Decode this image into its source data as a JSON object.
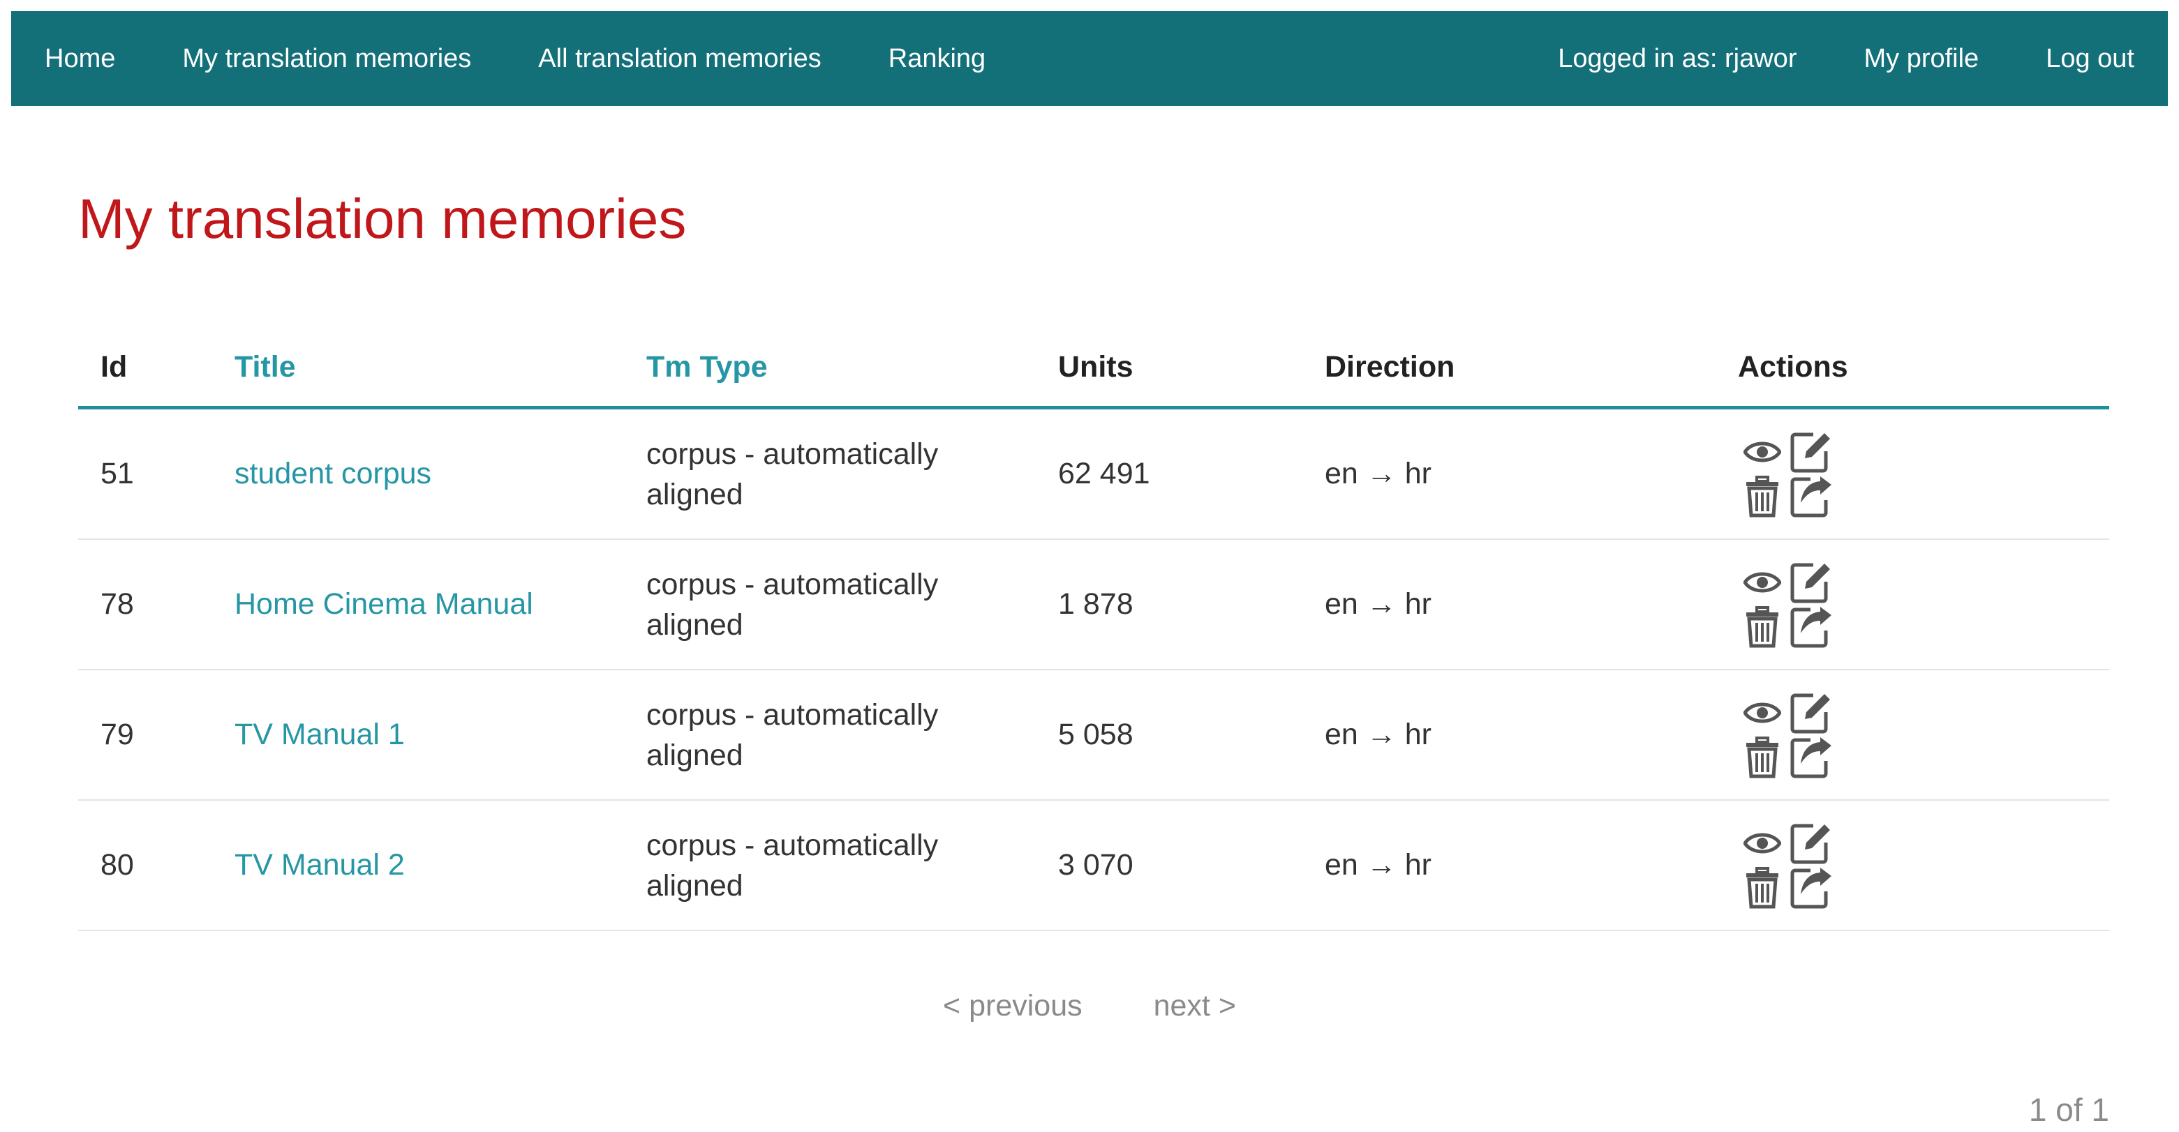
{
  "nav": {
    "home": "Home",
    "my_tms": "My translation memories",
    "all_tms": "All translation memories",
    "ranking": "Ranking",
    "logged_in": "Logged in as: rjawor",
    "my_profile": "My profile",
    "log_out": "Log out"
  },
  "page": {
    "title": "My translation memories"
  },
  "table": {
    "headers": {
      "id": "Id",
      "title": "Title",
      "tm_type": "Tm Type",
      "units": "Units",
      "direction": "Direction",
      "actions": "Actions"
    },
    "rows": [
      {
        "id": "51",
        "title": "student corpus",
        "type_line1": "corpus - automatically",
        "type_line2": "aligned",
        "units": "62 491",
        "direction": "en → hr"
      },
      {
        "id": "78",
        "title": "Home Cinema Manual",
        "type_line1": "corpus - automatically",
        "type_line2": "aligned",
        "units": "1 878",
        "direction": "en → hr"
      },
      {
        "id": "79",
        "title": "TV Manual 1",
        "type_line1": "corpus - automatically",
        "type_line2": "aligned",
        "units": "5 058",
        "direction": "en → hr"
      },
      {
        "id": "80",
        "title": "TV Manual 2",
        "type_line1": "corpus - automatically",
        "type_line2": "aligned",
        "units": "3 070",
        "direction": "en → hr"
      }
    ],
    "action_icons": [
      "eye-icon",
      "edit-icon",
      "trash-icon",
      "export-icon"
    ]
  },
  "pagination": {
    "previous": "< previous",
    "next": "next >",
    "page_count": "1 of 1"
  },
  "colors": {
    "navbar": "#136f78",
    "title": "#c0171b",
    "link": "#2596a4",
    "header_rule": "#1f8e9b",
    "icon": "#555555"
  }
}
